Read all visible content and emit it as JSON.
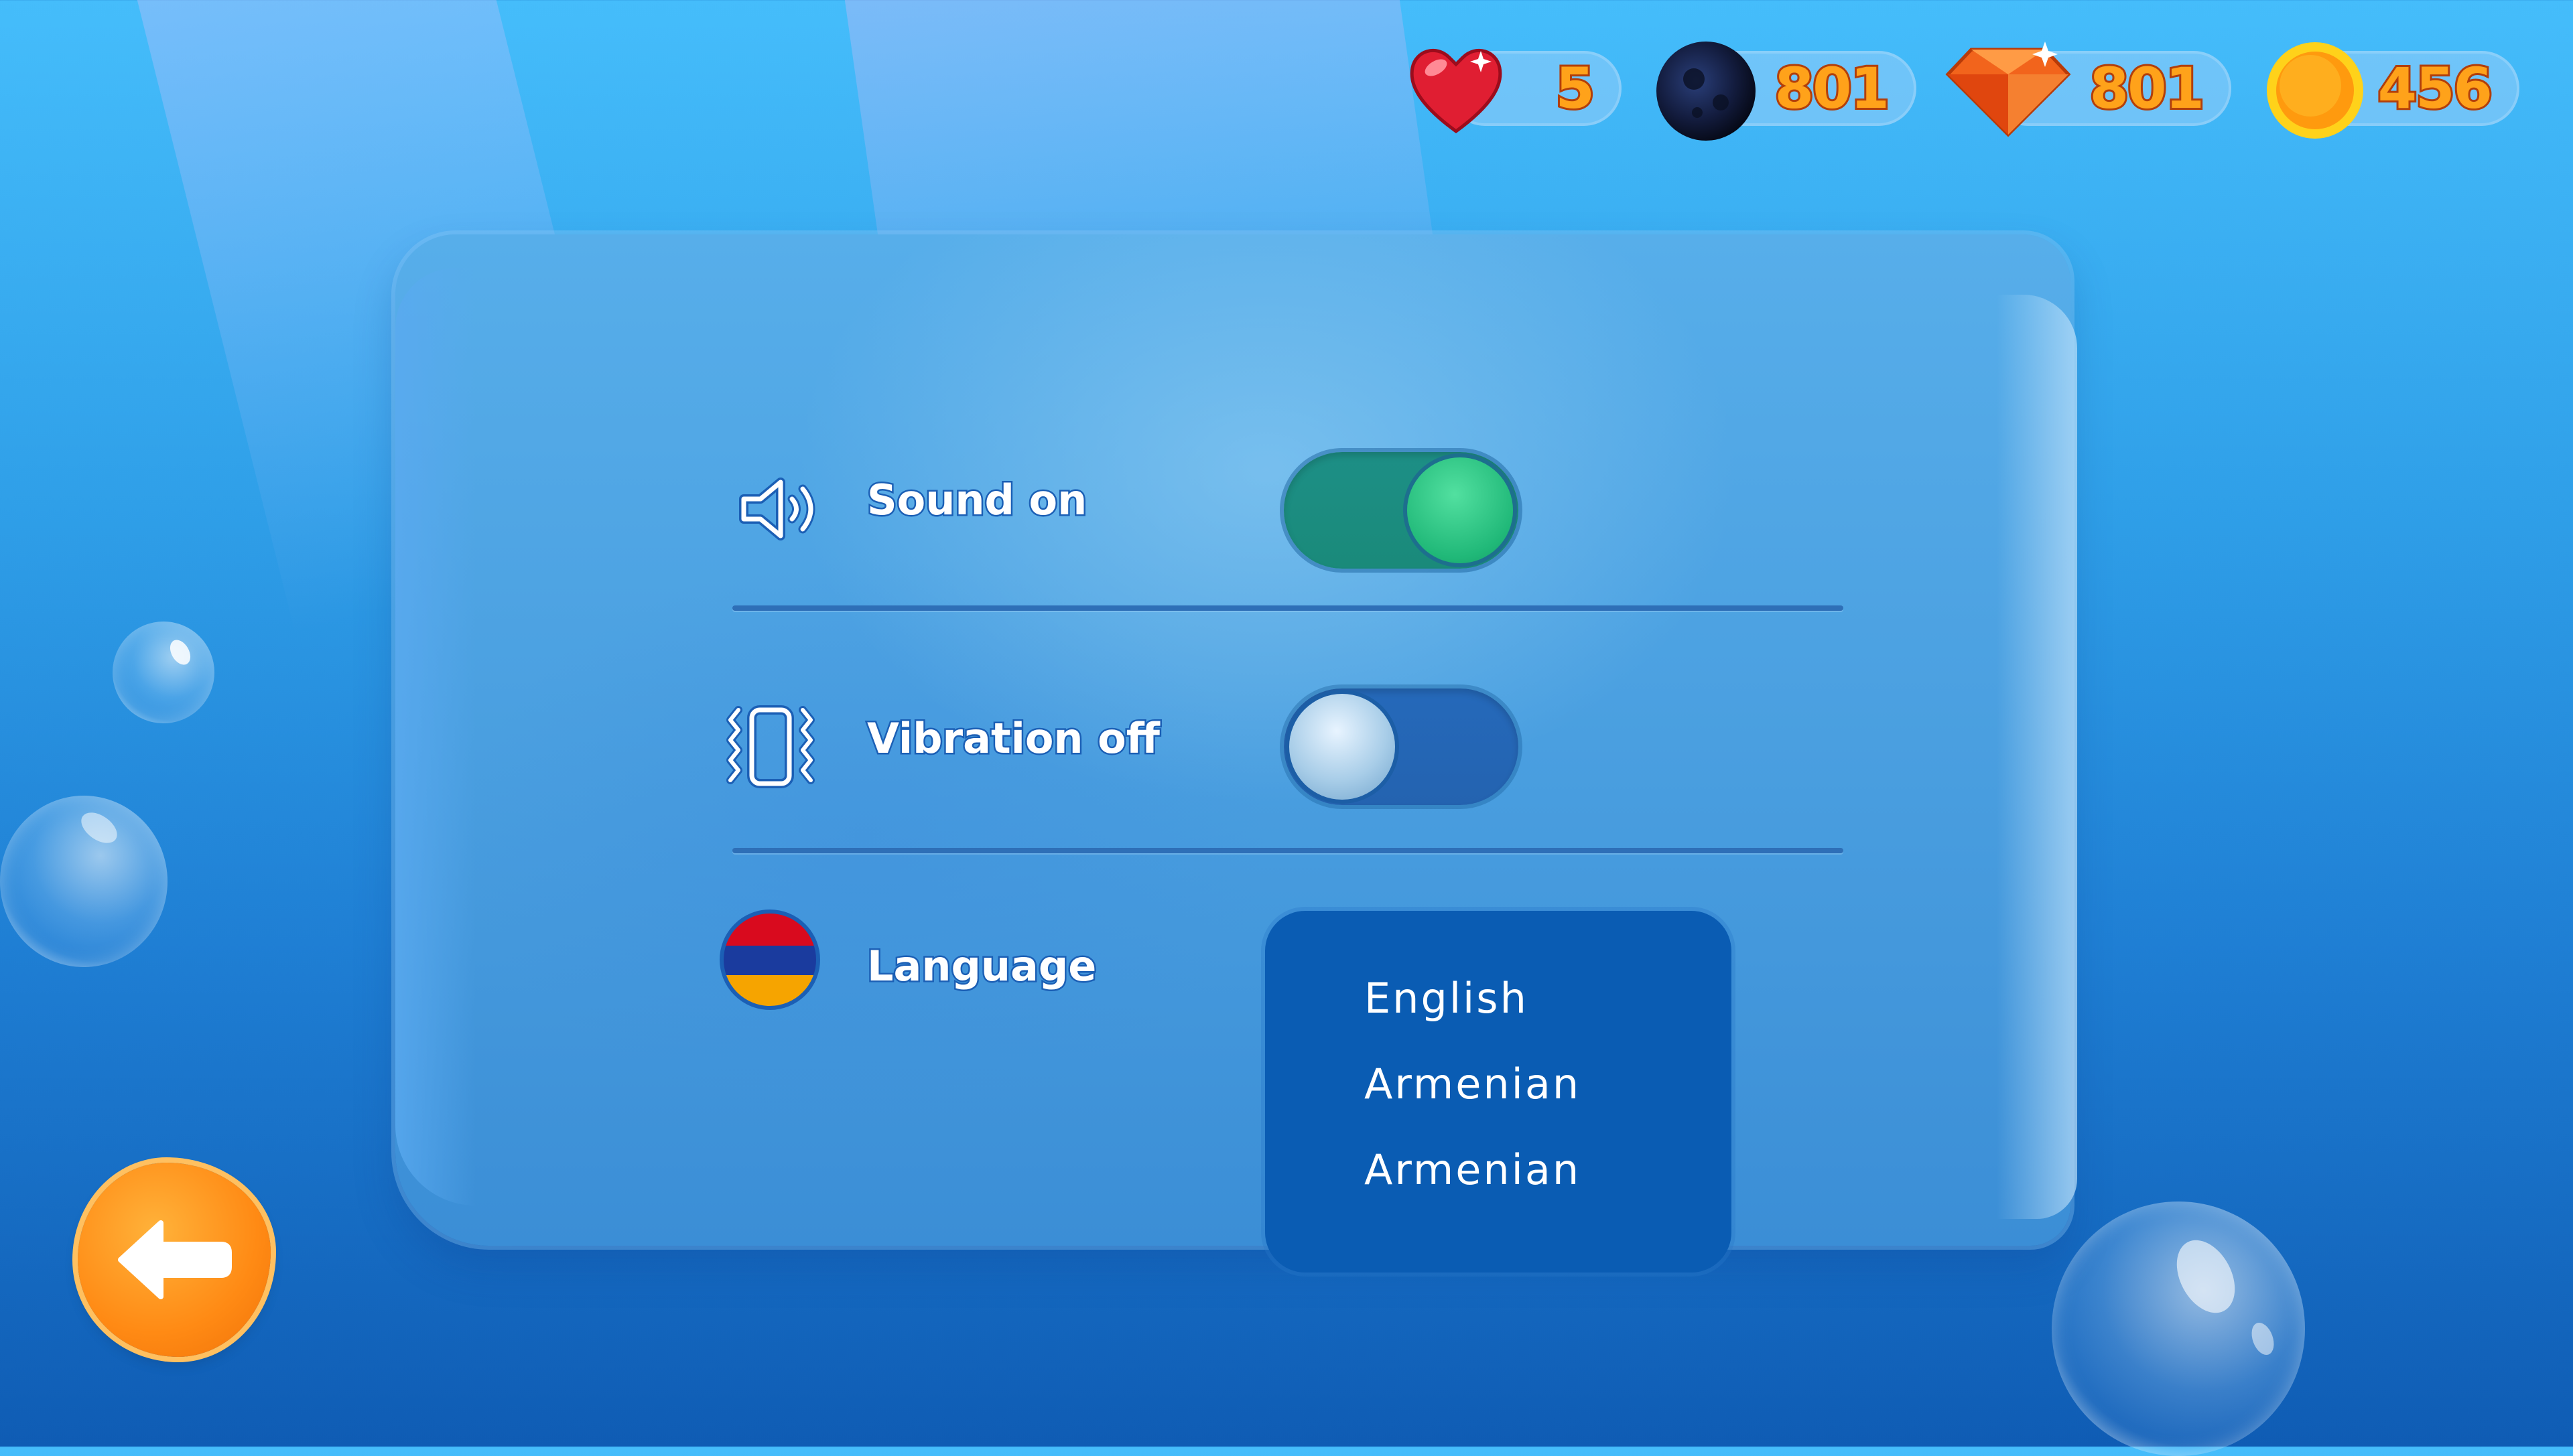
{
  "hud": {
    "lives": {
      "value": "5",
      "icon": "heart-icon"
    },
    "planets": {
      "value": "801",
      "icon": "moon-icon"
    },
    "gems": {
      "value": "801",
      "icon": "gem-icon"
    },
    "coins": {
      "value": "456",
      "icon": "coin-icon"
    }
  },
  "settings": {
    "sound": {
      "label": "Sound on",
      "on": true,
      "icon": "speaker-icon"
    },
    "vibration": {
      "label": "Vibration off",
      "on": false,
      "icon": "vibration-icon"
    },
    "language": {
      "label": "Language",
      "icon": "armenian-flag-icon",
      "options": [
        "English",
        "Armenian",
        "Armenian"
      ]
    }
  },
  "colors": {
    "accent_orange": "#ff8a14",
    "toggle_on": "#1d8f86",
    "dropdown_bg": "#0a5cb3",
    "counter_text": "#ffa21a"
  },
  "back_button": {
    "icon": "back-arrow-icon"
  }
}
